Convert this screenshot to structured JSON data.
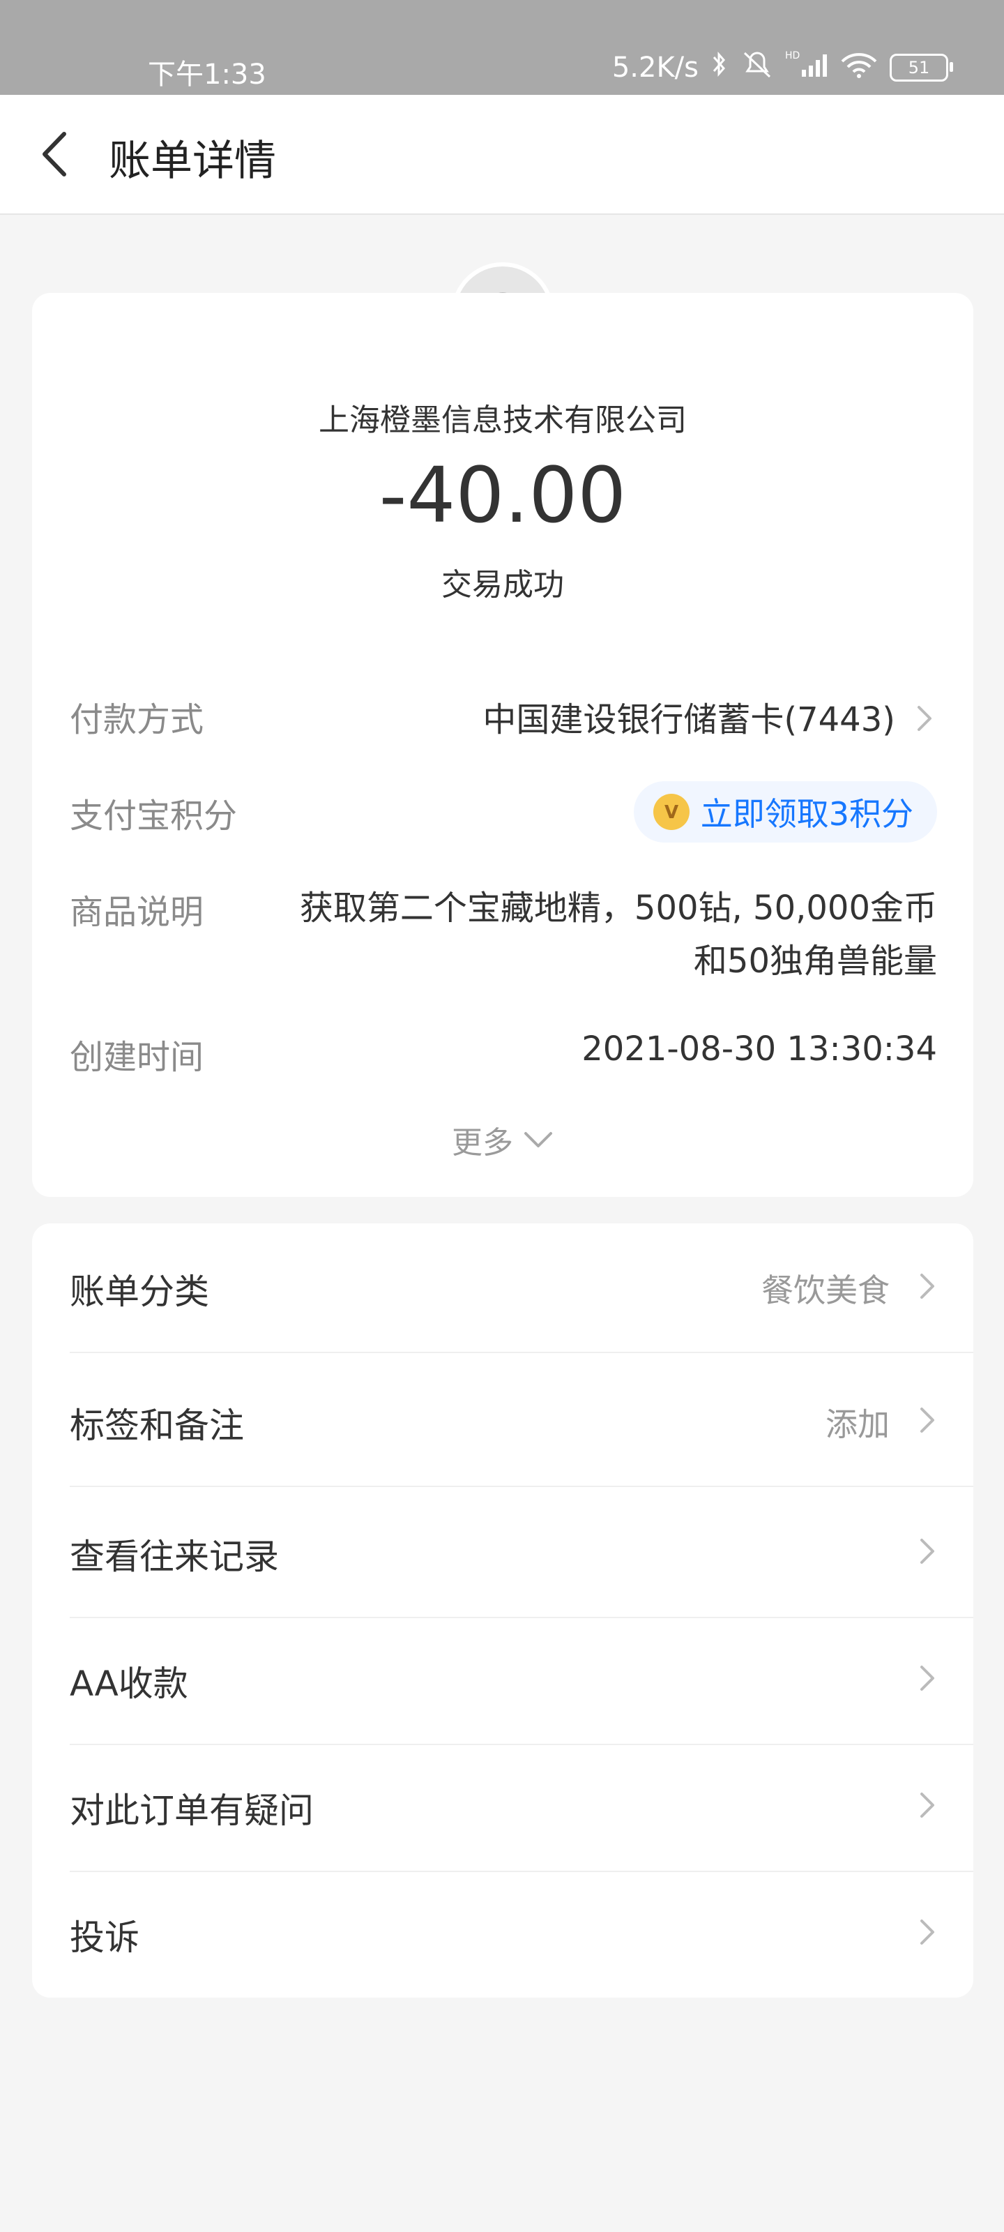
{
  "status_bar": {
    "time": "下午1:33",
    "network_speed": "5.2K/s",
    "battery": "51",
    "icons": [
      "bluetooth-icon",
      "mute-icon",
      "hd-icon",
      "signal-icon",
      "wifi-icon",
      "battery-icon"
    ]
  },
  "nav": {
    "title": "账单详情",
    "back_icon": "back-icon"
  },
  "bill": {
    "merchant": "上海橙墨信息技术有限公司",
    "amount": "-40.00",
    "status": "交易成功",
    "rows": {
      "payment": {
        "label": "付款方式",
        "value": "中国建设银行储蓄卡(7443)"
      },
      "points": {
        "label": "支付宝积分",
        "value": "立即领取3积分",
        "coin_glyph": "V"
      },
      "desc": {
        "label": "商品说明",
        "value": "获取第二个宝藏地精，500钻, 50,000金币和50独角兽能量"
      },
      "created": {
        "label": "创建时间",
        "value": "2021-08-30 13:30:34"
      }
    },
    "more": "更多"
  },
  "list": {
    "items": [
      {
        "label": "账单分类",
        "value": "餐饮美食"
      },
      {
        "label": "标签和备注",
        "value": "添加"
      },
      {
        "label": "查看往来记录",
        "value": ""
      },
      {
        "label": "AA收款",
        "value": ""
      },
      {
        "label": "对此订单有疑问",
        "value": ""
      },
      {
        "label": "投诉",
        "value": ""
      }
    ]
  },
  "colors": {
    "status_bar": "#a9a9a9",
    "background": "#f5f5f5",
    "card": "#ffffff",
    "accent": "#1677ff",
    "label_gray": "#8a8a8a",
    "coin": "#f6c548"
  }
}
